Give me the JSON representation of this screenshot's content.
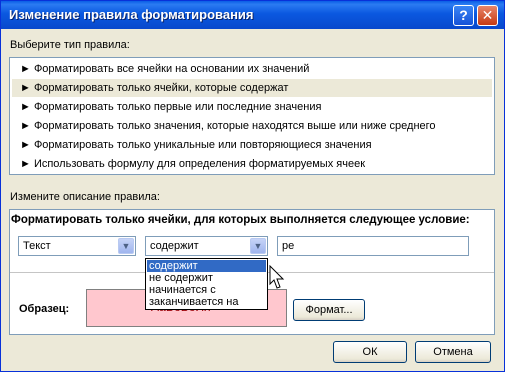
{
  "dialog": {
    "title": "Изменение правила форматирования",
    "help_glyph": "?",
    "close_glyph": "✕"
  },
  "rule_type": {
    "label": "Выберите тип правила:",
    "items": [
      {
        "label": "► Форматировать все ячейки на основании их значений"
      },
      {
        "label": "► Форматировать только ячейки, которые содержат"
      },
      {
        "label": "► Форматировать только первые или последние значения"
      },
      {
        "label": "► Форматировать только значения, которые находятся выше или ниже среднего"
      },
      {
        "label": "► Форматировать только уникальные или повторяющиеся значения"
      },
      {
        "label": "► Использовать формулу для определения форматируемых ячеек"
      }
    ],
    "selected_index": 1
  },
  "description": {
    "label": "Измените описание правила:",
    "header": "Форматировать только ячейки, для которых выполняется следующее условие:",
    "condition_field": {
      "value": "Текст"
    },
    "operator_field": {
      "value": "содержит"
    },
    "text_value": "ре",
    "operator_options": [
      "содержит",
      "не содержит",
      "начинается с",
      "заканчивается на"
    ],
    "operator_selected_index": 0,
    "preview_label": "Образец:",
    "preview_text": "АаВбБбЯя",
    "format_button": "Формат..."
  },
  "footer": {
    "ok": "ОК",
    "cancel": "Отмена"
  },
  "colors": {
    "titlebar": "#0a58e0",
    "preview_fill": "#ffc7ce",
    "preview_text": "#9c0006",
    "selection": "#316ac5"
  }
}
